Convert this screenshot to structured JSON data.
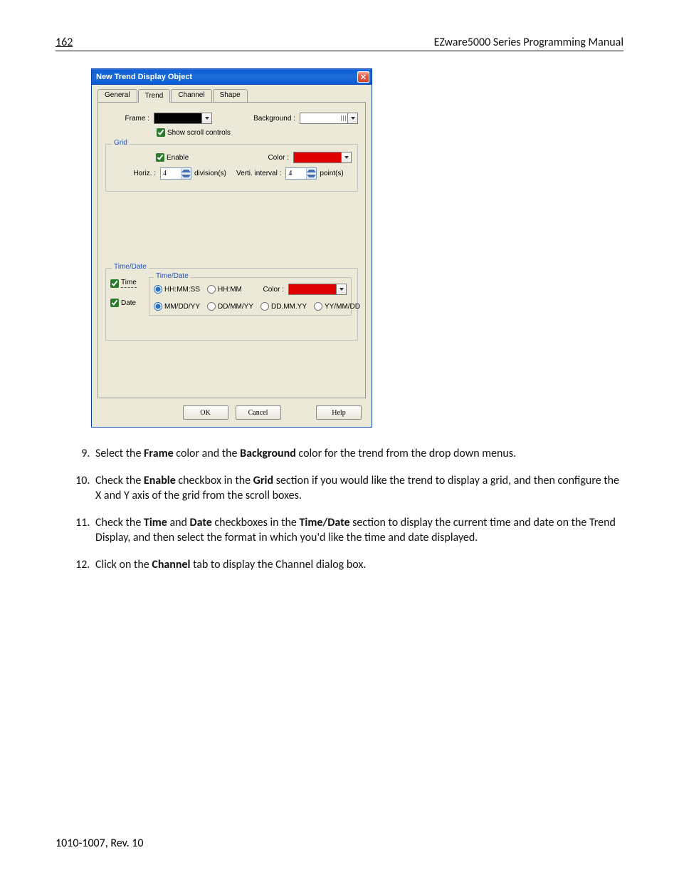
{
  "header": {
    "page_number": "162",
    "title": "EZware5000 Series Programming Manual"
  },
  "dialog": {
    "title": "New  Trend Display Object",
    "tabs": {
      "general": "General",
      "trend": "Trend",
      "channel": "Channel",
      "shape": "Shape",
      "active": "Trend"
    },
    "frame_label": "Frame :",
    "background_label": "Background :",
    "show_scroll": "Show scroll controls",
    "grid": {
      "legend": "Grid",
      "enable": "Enable",
      "color_label": "Color :",
      "horiz_label": "Horiz. :",
      "horiz_value": "4",
      "horiz_unit": "division(s)",
      "verti_label": "Verti. interval :",
      "verti_value": "4",
      "verti_unit": "point(s)"
    },
    "timedate": {
      "outer_legend": "Time/Date",
      "inner_legend": "Time/Date",
      "time_chk": "Time",
      "date_chk": "Date",
      "color_label": "Color :",
      "time_fmt": {
        "hhmmss": "HH:MM:SS",
        "hhmm": "HH:MM"
      },
      "date_fmt": {
        "mmddyy": "MM/DD/YY",
        "ddmmyy": "DD/MM/YY",
        "dd_mm_yy": "DD.MM.YY",
        "yymmdd": "YY/MM/DD"
      }
    },
    "buttons": {
      "ok": "OK",
      "cancel": "Cancel",
      "help": "Help"
    }
  },
  "instructions": {
    "i9a": "Select the ",
    "i9b": "Frame",
    "i9c": " color and the ",
    "i9d": "Background",
    "i9e": " color for the trend from the drop down menus.",
    "i10a": "Check the ",
    "i10b": "Enable",
    "i10c": " checkbox in the ",
    "i10d": "Grid",
    "i10e": " section if you would like the trend to display a grid, and then configure the X and Y axis of the grid from the scroll boxes.",
    "i11a": "Check the ",
    "i11b": "Time",
    "i11c": " and ",
    "i11d": "Date",
    "i11e": " checkboxes in the ",
    "i11f": "Time/Date",
    "i11g": " section to display the current time and date on the Trend Display, and then select the format in which you'd like the time and date displayed.",
    "i12a": "Click on the ",
    "i12b": "Channel",
    "i12c": " tab to display the Channel dialog box."
  },
  "footer": "1010-1007, Rev. 10"
}
